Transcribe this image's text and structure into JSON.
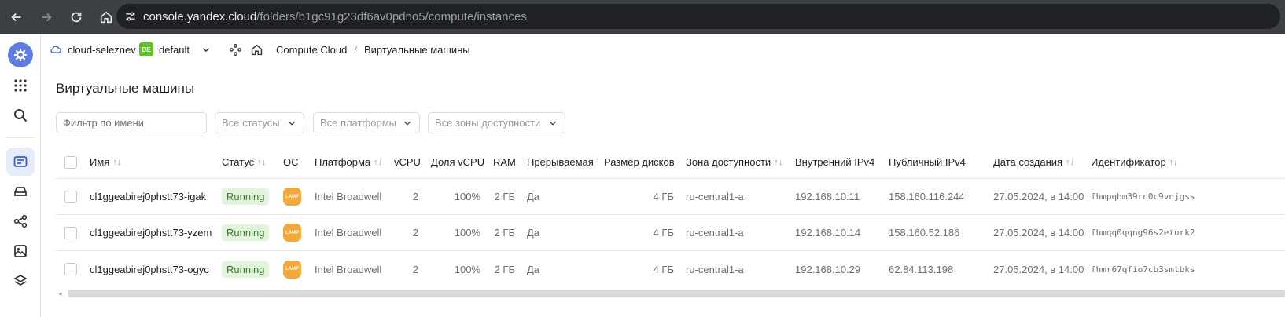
{
  "browser": {
    "url_host": "console.yandex.cloud",
    "url_path": "/folders/b1gc91g23df6av0pdno5/compute/instances"
  },
  "header": {
    "cloud_name": "cloud-seleznev",
    "folder_badge": "DE",
    "folder_name": "default",
    "breadcrumb_service": "Compute Cloud",
    "breadcrumb_separator": "/",
    "breadcrumb_current": "Виртуальные машины"
  },
  "page": {
    "title": "Виртуальные машины"
  },
  "filters": {
    "name_placeholder": "Фильтр по имени",
    "status": "Все статусы",
    "platform": "Все платформы",
    "zone": "Все зоны доступности"
  },
  "table": {
    "columns": {
      "name": "Имя",
      "status": "Статус",
      "os": "ОС",
      "platform": "Платформа",
      "vcpu": "vCPU",
      "vcpu_share": "Доля vCPU",
      "ram": "RAM",
      "preemptible": "Прерываемая",
      "disk_size": "Размер дисков",
      "zone": "Зона доступности",
      "internal_ip": "Внутренний IPv4",
      "public_ip": "Публичный IPv4",
      "created": "Дата создания",
      "id": "Идентификатор"
    },
    "sort_glyph": "↑↓",
    "rows": [
      {
        "name": "cl1ggeabirej0phstt73-igak",
        "status": "Running",
        "os_label": "LAMP",
        "platform": "Intel Broadwell",
        "vcpu": "2",
        "vcpu_share": "100%",
        "ram": "2 ГБ",
        "preemptible": "Да",
        "disk_size": "4 ГБ",
        "zone": "ru-central1-a",
        "internal_ip": "192.168.10.11",
        "public_ip": "158.160.116.244",
        "created": "27.05.2024, в 14:00",
        "id": "fhmpqhm39rn0c9vnjgss"
      },
      {
        "name": "cl1ggeabirej0phstt73-yzem",
        "status": "Running",
        "os_label": "LAMP",
        "platform": "Intel Broadwell",
        "vcpu": "2",
        "vcpu_share": "100%",
        "ram": "2 ГБ",
        "preemptible": "Да",
        "disk_size": "4 ГБ",
        "zone": "ru-central1-a",
        "internal_ip": "192.168.10.14",
        "public_ip": "158.160.52.186",
        "created": "27.05.2024, в 14:00",
        "id": "fhmqq0qqng96s2eturk2"
      },
      {
        "name": "cl1ggeabirej0phstt73-ogyc",
        "status": "Running",
        "os_label": "LAMP",
        "platform": "Intel Broadwell",
        "vcpu": "2",
        "vcpu_share": "100%",
        "ram": "2 ГБ",
        "preemptible": "Да",
        "disk_size": "4 ГБ",
        "zone": "ru-central1-a",
        "internal_ip": "192.168.10.29",
        "public_ip": "62.84.113.198",
        "created": "27.05.2024, в 14:00",
        "id": "fhmr67qfio7cb3smtbks"
      }
    ]
  },
  "colors": {
    "accent": "#5e7ce2",
    "status_running_bg": "#e3f4dd",
    "status_running_text": "#3a7d2c",
    "lamp": "#f3a83a",
    "folder_badge": "#62c12c"
  }
}
